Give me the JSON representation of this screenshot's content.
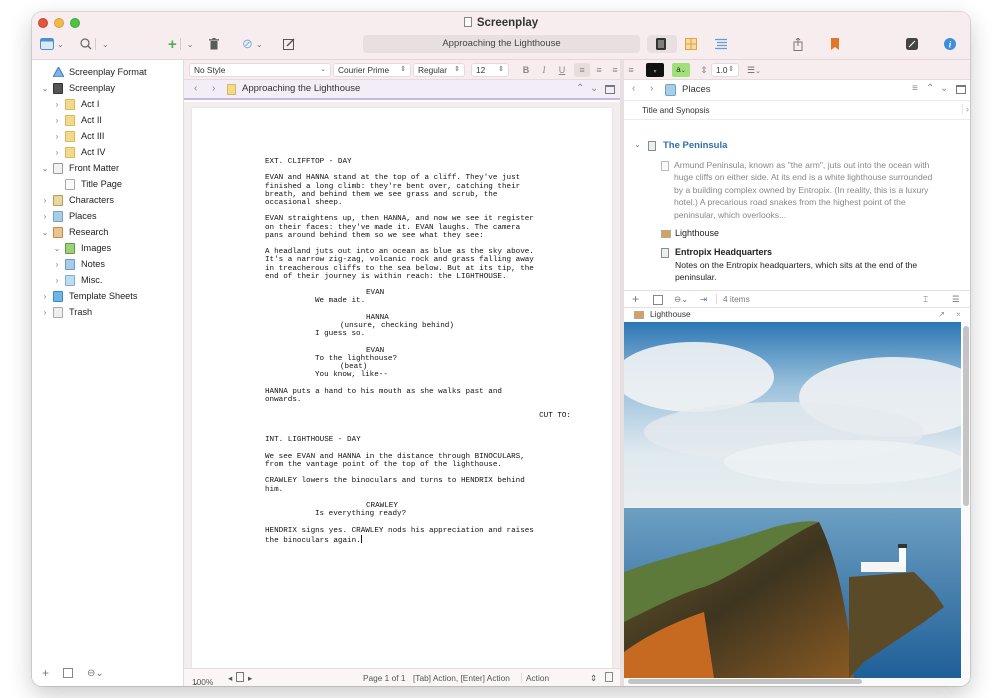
{
  "window": {
    "title": "Screenplay"
  },
  "toolbar": {
    "navigation_field": "Approaching the Lighthouse",
    "icons": [
      "sidebar-toggle-icon",
      "search-icon",
      "add-icon",
      "trash-icon",
      "attachment-icon",
      "compose-icon",
      "document-view-icon",
      "corkboard-icon",
      "outliner-icon",
      "share-icon",
      "bookmark-icon",
      "compile-icon",
      "inspector-info-icon"
    ]
  },
  "binder": {
    "items": [
      {
        "label": "Screenplay Format",
        "depth": 0,
        "disclosure": "",
        "icon": "screenplay-format-icon"
      },
      {
        "label": "Screenplay",
        "depth": 0,
        "disclosure": "expanded",
        "icon": "draft-folder-icon"
      },
      {
        "label": "Act I",
        "depth": 1,
        "disclosure": "collapsed",
        "icon": "folder-icon"
      },
      {
        "label": "Act II",
        "depth": 1,
        "disclosure": "collapsed",
        "icon": "folder-icon"
      },
      {
        "label": "Act III",
        "depth": 1,
        "disclosure": "collapsed",
        "icon": "folder-icon"
      },
      {
        "label": "Act IV",
        "depth": 1,
        "disclosure": "collapsed",
        "icon": "folder-icon"
      },
      {
        "label": "Front Matter",
        "depth": 0,
        "disclosure": "expanded",
        "icon": "front-matter-icon"
      },
      {
        "label": "Title Page",
        "depth": 1,
        "disclosure": "",
        "icon": "document-icon"
      },
      {
        "label": "Characters",
        "depth": 0,
        "disclosure": "collapsed",
        "icon": "characters-icon"
      },
      {
        "label": "Places",
        "depth": 0,
        "disclosure": "collapsed",
        "icon": "places-icon"
      },
      {
        "label": "Research",
        "depth": 0,
        "disclosure": "expanded",
        "icon": "research-icon"
      },
      {
        "label": "Images",
        "depth": 1,
        "disclosure": "expanded",
        "icon": "images-folder-icon"
      },
      {
        "label": "Notes",
        "depth": 1,
        "disclosure": "collapsed",
        "icon": "notes-folder-icon"
      },
      {
        "label": "Misc.",
        "depth": 1,
        "disclosure": "collapsed",
        "icon": "misc-folder-icon"
      },
      {
        "label": "Template Sheets",
        "depth": 0,
        "disclosure": "collapsed",
        "icon": "template-sheets-icon"
      },
      {
        "label": "Trash",
        "depth": 0,
        "disclosure": "collapsed",
        "icon": "trash-icon"
      }
    ]
  },
  "format_bar": {
    "style": "No Style",
    "font": "Courier Prime",
    "weight": "Regular",
    "size": "12",
    "bold": "B",
    "italic": "I",
    "underline": "U",
    "line_spacing": "1.0",
    "highlight_label": "a"
  },
  "editor": {
    "header_title": "Approaching the Lighthouse",
    "script": [
      {
        "type": "scene",
        "text": "EXT. CLIFFTOP - DAY"
      },
      {
        "type": "action",
        "text": "EVAN and HANNA stand at the top of a cliff. They've just\nfinished a long climb: they're bent over, catching their\nbreath, and behind them we see grass and scrub, the\noccasional sheep."
      },
      {
        "type": "action",
        "text": "EVAN straightens up, then HANNA, and now we see it register\non their faces: they've made it. EVAN laughs. The camera\npans around behind them so we see what they see:"
      },
      {
        "type": "action",
        "text": "A headland juts out into an ocean as blue as the sky above.\nIt's a narrow zig-zag, volcanic rock and grass falling away\nin treacherous cliffs to the sea below. But at its tip, the\nend of their journey is within reach: the LIGHTHOUSE."
      },
      {
        "type": "char",
        "text": "EVAN"
      },
      {
        "type": "dlg",
        "text": "We made it."
      },
      {
        "type": "char",
        "text": "HANNA"
      },
      {
        "type": "paren",
        "text": "(unsure, checking behind)"
      },
      {
        "type": "dlg",
        "text": "I guess so."
      },
      {
        "type": "char",
        "text": "EVAN"
      },
      {
        "type": "dlg-nb",
        "text": "To the lighthouse?"
      },
      {
        "type": "paren",
        "text": "(beat)"
      },
      {
        "type": "dlg",
        "text": "You know, like--"
      },
      {
        "type": "action",
        "text": "HANNA puts a hand to his mouth as she walks past and\nonwards."
      },
      {
        "type": "trans",
        "text": "CUT TO:"
      },
      {
        "type": "scene",
        "text": "INT. LIGHTHOUSE - DAY"
      },
      {
        "type": "action",
        "text": "We see EVAN and HANNA in the distance through BINOCULARS,\nfrom the vantage point of the top of the lighthouse."
      },
      {
        "type": "action",
        "text": "CRAWLEY lowers the binoculars and turns to HENDRIX behind\nhim."
      },
      {
        "type": "char",
        "text": "CRAWLEY"
      },
      {
        "type": "dlg",
        "text": "Is everything ready?"
      },
      {
        "type": "action-last",
        "text": "HENDRIX signs yes. CRAWLEY nods his appreciation and raises\nthe binoculars again."
      }
    ],
    "footer": {
      "zoom": "100%",
      "page": "Page 1 of 1",
      "hint": "[Tab] Action, [Enter] Action",
      "element": "Action"
    }
  },
  "places": {
    "header_title": "Places",
    "column_header": "Title and Synopsis",
    "items": [
      {
        "title": "The Peninsula",
        "synopsis": "",
        "icon": "text-document-icon"
      },
      {
        "title": "",
        "synopsis": "Armund Peninsula, known as \"the arm\", juts out into the ocean with\nhuge cliffs on either side. At its end is a white lighthouse surrounded\nby a building complex owned by Entropix. (In reality, this is a luxury\nhotel.) A precarious road snakes from the highest point of the\npeninsular, which overlooks..."
      },
      {
        "title": "Lighthouse",
        "synopsis": "",
        "icon": "image-icon"
      },
      {
        "title": "Entropix Headquarters",
        "synopsis": "Notes on the Entropix headquarters, which sits at the end of the\npeninsular.",
        "icon": "text-document-icon"
      }
    ],
    "footer_count": "4 items"
  },
  "image_pane": {
    "title": "Lighthouse"
  },
  "colors": {
    "titlebar": "#f7ecee",
    "accent_blue": "#2f6fa8",
    "bookmark_orange": "#e0762c",
    "corkboard_orange": "#e3a33c",
    "add_green": "#4cae4c"
  }
}
